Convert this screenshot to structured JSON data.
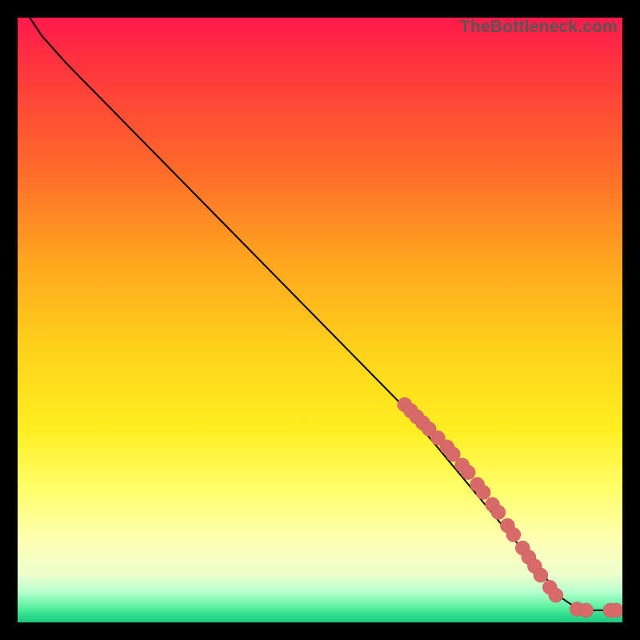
{
  "watermark": "TheBottleneck.com",
  "colors": {
    "dot_fill": "#d86a6a",
    "dot_stroke": "#c85a5a",
    "curve": "#000000",
    "frame": "#000000"
  },
  "chart_data": {
    "type": "line",
    "title": "",
    "xlabel": "",
    "ylabel": "",
    "xlim": [
      0,
      100
    ],
    "ylim": [
      0,
      100
    ],
    "grid": false,
    "curve": [
      {
        "x": 2,
        "y": 100
      },
      {
        "x": 4,
        "y": 97
      },
      {
        "x": 8,
        "y": 92.5
      },
      {
        "x": 64,
        "y": 35.5
      },
      {
        "x": 86,
        "y": 9
      },
      {
        "x": 90,
        "y": 4
      },
      {
        "x": 93,
        "y": 2
      },
      {
        "x": 96,
        "y": 2
      },
      {
        "x": 99,
        "y": 2
      }
    ],
    "series": [
      {
        "name": "markers",
        "points": [
          {
            "x": 64,
            "y": 36
          },
          {
            "x": 65,
            "y": 35
          },
          {
            "x": 66,
            "y": 34
          },
          {
            "x": 67,
            "y": 33
          },
          {
            "x": 68,
            "y": 32
          },
          {
            "x": 69.5,
            "y": 30.5
          },
          {
            "x": 71,
            "y": 29
          },
          {
            "x": 72,
            "y": 27.8
          },
          {
            "x": 73.5,
            "y": 26
          },
          {
            "x": 74.5,
            "y": 24.8
          },
          {
            "x": 76,
            "y": 22.8
          },
          {
            "x": 77,
            "y": 21.5
          },
          {
            "x": 78.5,
            "y": 19.5
          },
          {
            "x": 79.5,
            "y": 18.2
          },
          {
            "x": 81,
            "y": 16
          },
          {
            "x": 82,
            "y": 14.5
          },
          {
            "x": 83.5,
            "y": 12.3
          },
          {
            "x": 84.5,
            "y": 10.8
          },
          {
            "x": 85.5,
            "y": 9.3
          },
          {
            "x": 86.5,
            "y": 7.8
          },
          {
            "x": 88,
            "y": 5.8
          },
          {
            "x": 89,
            "y": 4.5
          },
          {
            "x": 92.5,
            "y": 2.2
          },
          {
            "x": 94,
            "y": 2.0
          },
          {
            "x": 98,
            "y": 2.0
          },
          {
            "x": 99,
            "y": 2.0
          }
        ]
      }
    ]
  }
}
